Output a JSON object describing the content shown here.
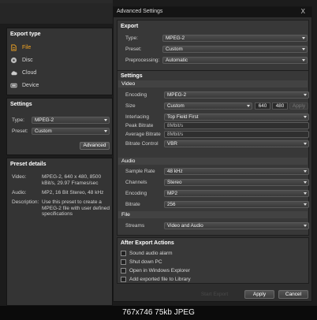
{
  "dialog": {
    "title": "Advanced Settings",
    "close_label": "X",
    "export": {
      "header": "Export",
      "type_label": "Type:",
      "type_value": "MPEG-2",
      "preset_label": "Preset:",
      "preset_value": "Custom",
      "preprocessing_label": "Preprocessing:",
      "preprocessing_value": "Automatic"
    },
    "settings": {
      "header": "Settings",
      "video_header": "Video",
      "encoding_label": "Encoding",
      "encoding_value": "MPEG-2",
      "size_label": "Size",
      "size_value": "Custom",
      "width": "640",
      "height": "480",
      "apply_small": "Apply",
      "interlacing_label": "Interlacing",
      "interlacing_value": "Top Field First",
      "peak_bitrate_label": "Peak Bitrate",
      "peak_bitrate_value": "8Mbit/s",
      "average_bitrate_label": "Average Bitrate",
      "average_bitrate_value": "8Mbit/s",
      "bitrate_control_label": "Bitrate Control",
      "bitrate_control_value": "VBR",
      "audio_header": "Audio",
      "sample_rate_label": "Sample Rate",
      "sample_rate_value": "48 kHz",
      "channels_label": "Channels",
      "channels_value": "Stereo",
      "audio_encoding_label": "Encoding",
      "audio_encoding_value": "MP2",
      "audio_bitrate_label": "Bitrate",
      "audio_bitrate_value": "256",
      "file_header": "File",
      "streams_label": "Streams",
      "streams_value": "Video and Audio"
    },
    "after_export": {
      "header": "After Export Actions",
      "items": [
        "Sound audio alarm",
        "Shut down PC",
        "Open in Windows Explorer",
        "Add exported file to Library"
      ]
    },
    "apply_button": "Apply",
    "cancel_button": "Cancel",
    "start_export_button": "Start Export"
  },
  "left": {
    "export_type": {
      "title": "Export type",
      "options": [
        {
          "label": "File",
          "icon": "file-icon",
          "active": true
        },
        {
          "label": "Disc",
          "icon": "disc-icon"
        },
        {
          "label": "Cloud",
          "icon": "cloud-icon"
        },
        {
          "label": "Device",
          "icon": "device-icon"
        }
      ]
    },
    "settings": {
      "title": "Settings",
      "type_label": "Type:",
      "type_value": "MPEG-2",
      "preset_label": "Preset:",
      "preset_value": "Custom",
      "advanced_button": "Advanced"
    },
    "preset_details": {
      "title": "Preset details",
      "video_label": "Video:",
      "video_value": "MPEG-2, 640 x 480, 8500 kBit/s, 29.97 Frames/sec",
      "audio_label": "Audio:",
      "audio_value": "MP2, 16 Bit Stereo, 48 kHz",
      "description_label": "Description:",
      "description_value": "Use this preset to create a MPEG-2 file with user defined specifications"
    }
  },
  "caption": "767x746  75kb  JPEG",
  "colors": {
    "accent": "#f5a623",
    "panel": "#343434",
    "dialog": "#2e2e2e"
  }
}
